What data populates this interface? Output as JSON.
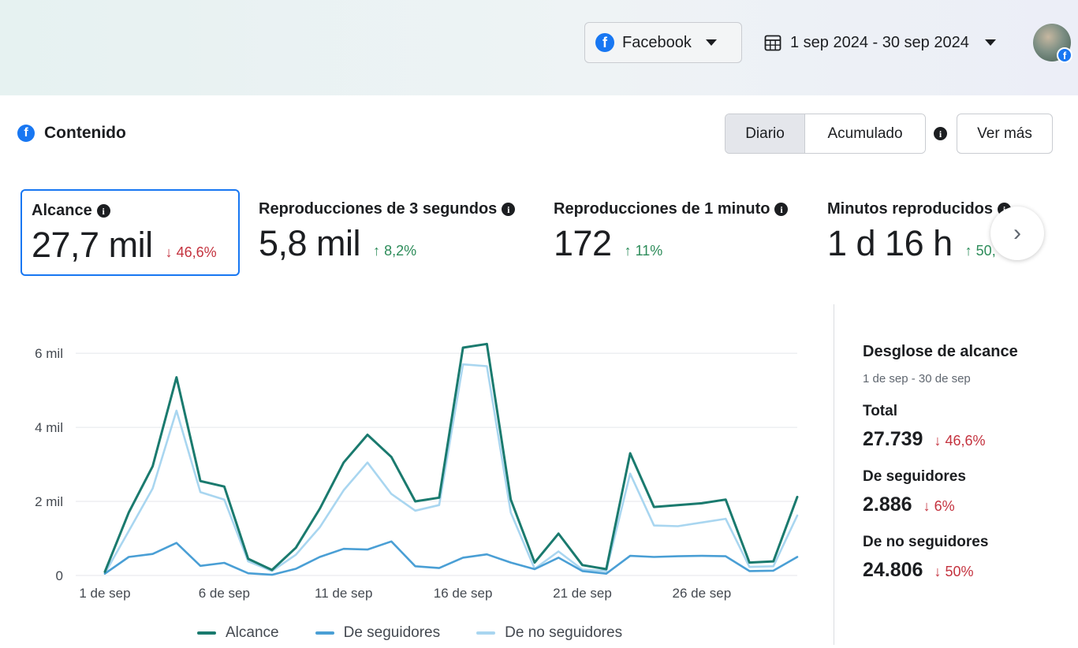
{
  "header": {
    "platform_label": "Facebook",
    "date_range": "1 sep 2024 - 30 sep 2024"
  },
  "section": {
    "title": "Contenido",
    "toggle": [
      "Diario",
      "Acumulado"
    ],
    "active_toggle": "Diario",
    "more_label": "Ver más"
  },
  "metrics": [
    {
      "label": "Alcance",
      "value": "27,7 mil",
      "delta": "46,6%",
      "direction": "down",
      "selected": true
    },
    {
      "label": "Reproducciones de 3 segundos",
      "value": "5,8 mil",
      "delta": "8,2%",
      "direction": "up"
    },
    {
      "label": "Reproducciones de 1 minuto",
      "value": "172",
      "delta": "11%",
      "direction": "up"
    },
    {
      "label": "Minutos reproducidos",
      "value": "1 d 16 h",
      "delta": "50,",
      "direction": "up"
    }
  ],
  "breakdown": {
    "title": "Desglose de alcance",
    "subtitle": "1 de sep - 30 de sep",
    "items": [
      {
        "label": "Total",
        "value": "27.739",
        "delta": "46,6%",
        "color": "#c4323e"
      },
      {
        "label": "De seguidores",
        "value": "2.886",
        "delta": "6%",
        "color": "#c4323e"
      },
      {
        "label": "De no seguidores",
        "value": "24.806",
        "delta": "50%",
        "color": "#c4323e"
      }
    ]
  },
  "colors": {
    "accent": "#1877f2",
    "down": "#c4323e",
    "up": "#2d8c5a"
  },
  "chart_data": {
    "type": "line",
    "x": [
      1,
      2,
      3,
      4,
      5,
      6,
      7,
      8,
      9,
      10,
      11,
      12,
      13,
      14,
      15,
      16,
      17,
      18,
      19,
      20,
      21,
      22,
      23,
      24,
      25,
      26,
      27,
      28,
      29,
      30
    ],
    "x_tick_positions": [
      1,
      6,
      11,
      16,
      21,
      26
    ],
    "x_tick_labels": [
      "1 de sep",
      "6 de sep",
      "11 de sep",
      "16 de sep",
      "21 de sep",
      "26 de sep"
    ],
    "y_tick_values": [
      0,
      2000,
      4000,
      6000
    ],
    "y_tick_labels": [
      "0",
      "2 mil",
      "4 mil",
      "6 mil"
    ],
    "ylim": [
      0,
      6300
    ],
    "grid": true,
    "legend_position": "bottom",
    "series": [
      {
        "name": "Alcance",
        "color": "#1a7a6e",
        "values": [
          100,
          1700,
          2950,
          5350,
          2550,
          2400,
          450,
          150,
          750,
          1800,
          3050,
          3800,
          3200,
          2000,
          2100,
          6150,
          6250,
          2050,
          350,
          1130,
          280,
          170,
          3300,
          1850,
          1900,
          1950,
          2050,
          350,
          380,
          2120
        ]
      },
      {
        "name": "De seguidores",
        "color": "#4a9fd5",
        "values": [
          50,
          500,
          580,
          880,
          260,
          340,
          60,
          20,
          180,
          500,
          720,
          700,
          920,
          250,
          200,
          480,
          570,
          350,
          170,
          480,
          120,
          50,
          530,
          500,
          520,
          530,
          520,
          120,
          130,
          500
        ]
      },
      {
        "name": "De no seguidores",
        "color": "#a9d6f0",
        "values": [
          60,
          1200,
          2350,
          4450,
          2250,
          2050,
          380,
          120,
          560,
          1300,
          2300,
          3050,
          2200,
          1750,
          1900,
          5700,
          5650,
          1700,
          180,
          650,
          160,
          120,
          2750,
          1350,
          1330,
          1430,
          1530,
          230,
          250,
          1620
        ]
      }
    ]
  }
}
